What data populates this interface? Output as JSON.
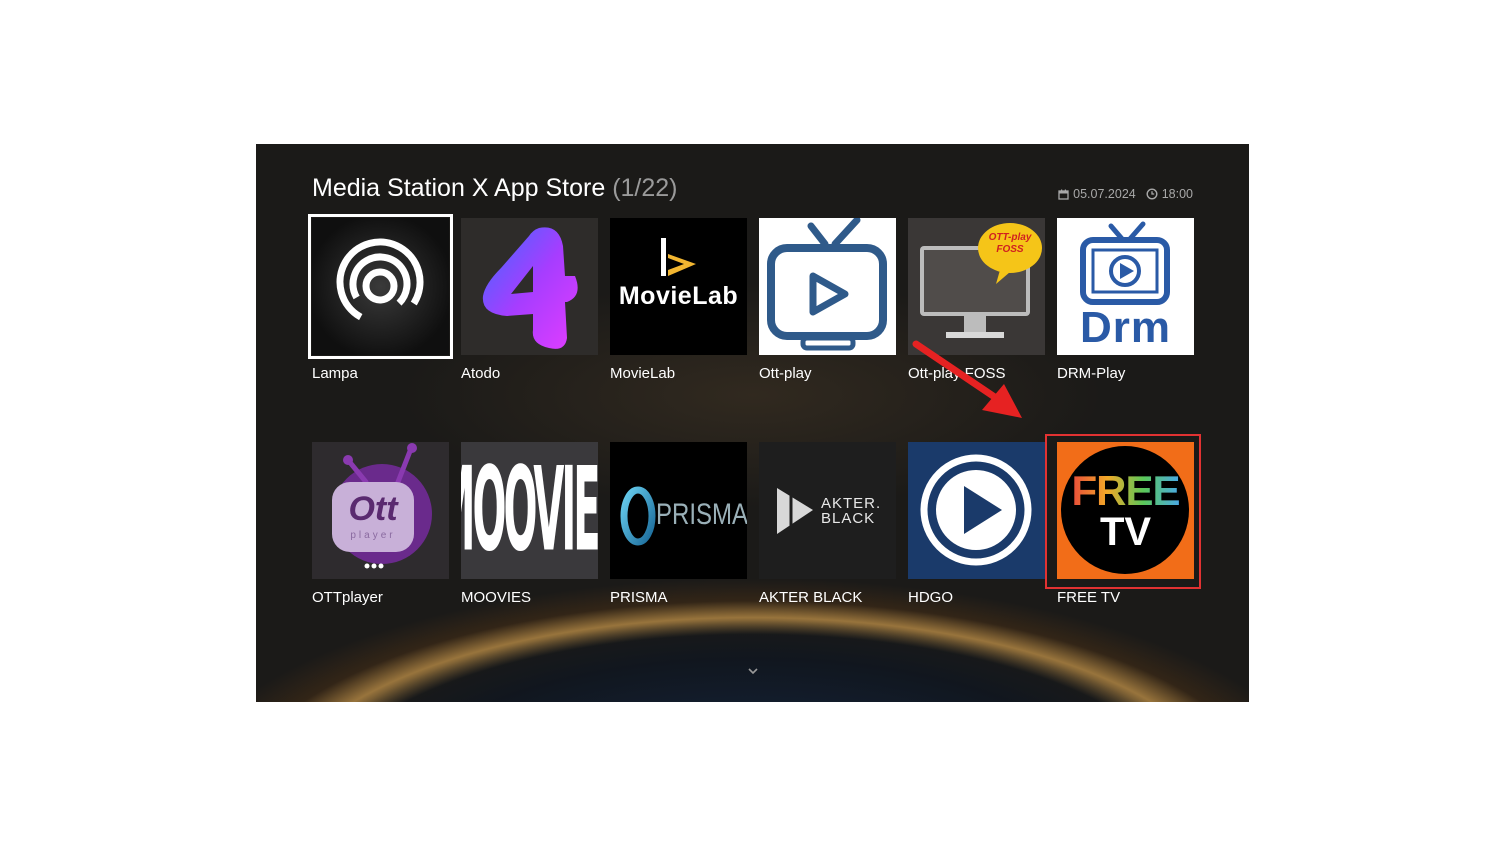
{
  "header": {
    "title": "Media Station X App Store",
    "page_indicator": "(1/22)"
  },
  "status": {
    "date": "05.07.2024",
    "time": "18:00",
    "date_icon": "calendar-icon",
    "time_icon": "clock-icon"
  },
  "apps": [
    {
      "label": "Lampa",
      "focused": true
    },
    {
      "label": "Atodo"
    },
    {
      "label": "MovieLab",
      "logo_text": "MovieLab"
    },
    {
      "label": "Ott-play"
    },
    {
      "label": "Ott-play FOSS",
      "logo_text_1": "OTT-play",
      "logo_text_2": "FOSS"
    },
    {
      "label": "DRM-Play",
      "logo_text": "Drm"
    },
    {
      "label": "OTTplayer",
      "logo_text": "Ott",
      "logo_sub": "player"
    },
    {
      "label": "MOOVIES",
      "logo_text": "MOOVIES"
    },
    {
      "label": "PRISMA",
      "logo_text": "PRISMA"
    },
    {
      "label": "AKTER BLACK",
      "logo_text_1": "AKTER.",
      "logo_text_2": "BLACK"
    },
    {
      "label": "HDGO"
    },
    {
      "label": "FREE TV",
      "logo_text_1": "FREE",
      "logo_text_2": "TV",
      "highlighted": true
    }
  ],
  "colors": {
    "background": "#1b1a18",
    "highlight": "#e23232",
    "text": "#ffffff",
    "muted": "#9a9a9a"
  },
  "more_indicator_icon": "chevron-down-icon"
}
